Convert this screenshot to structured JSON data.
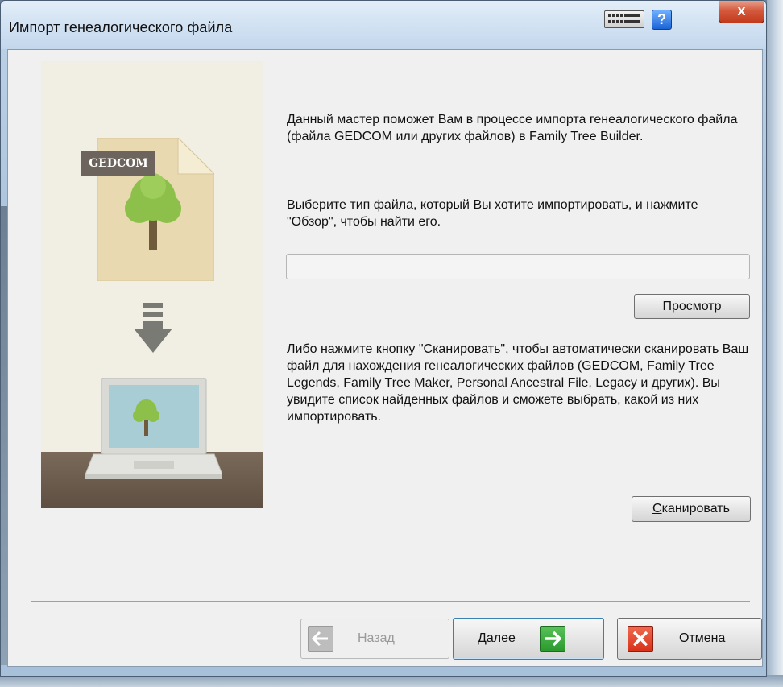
{
  "window": {
    "title": "Импорт генеалогического файла",
    "help_label": "?",
    "close_label": "x"
  },
  "illustration": {
    "tag": "GEDCOM"
  },
  "content": {
    "intro": "Данный мастер поможет Вам в процессе импорта генеалогического файла (файла GEDCOM или других файлов) в Family Tree Builder.",
    "instruction": "Выберите тип файла, который Вы хотите импортировать, и нажмите \"Обзор\", чтобы найти его.",
    "file_path_value": "",
    "browse_label": "Просмотр",
    "scan_info": "Либо нажмите кнопку \"Сканировать\", чтобы автоматически сканировать Ваш файл для нахождения генеалогических файлов (GEDCOM, Family Tree Legends, Family Tree Maker, Personal Ancestral File, Legacy и других). Вы увидите список найденных файлов и сможете выбрать, какой из них импортировать.",
    "scan_label_underlined": "С",
    "scan_label_rest": "канировать"
  },
  "footer": {
    "back_label": "Назад",
    "next_label": "Далее",
    "cancel_label": "Отмена"
  },
  "colors": {
    "next_icon": "#2b9a2d",
    "cancel_icon": "#d8321a",
    "tree_green": "#8cc04a"
  }
}
